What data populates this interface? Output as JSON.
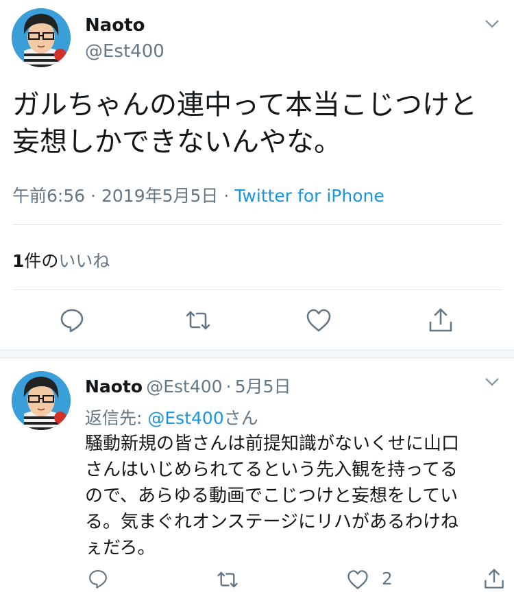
{
  "tweet": {
    "name": "Naoto",
    "handle": "@Est400",
    "text_line1": "ガルちゃんの連中って本当こじつけと",
    "text_line2": "妄想しかできないんやな。",
    "time": "午前6:56",
    "sep": "·",
    "date": "2019年5月5日",
    "source": "Twitter for iPhone",
    "likes_count": "1",
    "likes_suffix": "件の",
    "likes_label": "いいね"
  },
  "reply": {
    "name": "Naoto",
    "handle": "@Est400",
    "sep": "·",
    "date": "5月5日",
    "reply_to_label": "返信先:",
    "reply_to_mention": "@Est400",
    "reply_to_suffix": "さん",
    "line1": "騒動新規の皆さんは前提知識がないくせに山口",
    "line2": "さんはいじめられてるという先入観を持ってる",
    "line3": "ので、あらゆる動画でこじつけと妄想をしてい",
    "line4": "る。気まぐれオンステージにリハがあるわけね",
    "line5": "ぇだろ。",
    "like_count": "2"
  },
  "icons": [
    "avatar",
    "chevron-down-icon",
    "reply-icon",
    "retweet-icon",
    "like-icon",
    "share-icon"
  ],
  "colors": {
    "link": "#1b95e0",
    "secondary": "#657786",
    "divider": "#e1e8ed"
  }
}
